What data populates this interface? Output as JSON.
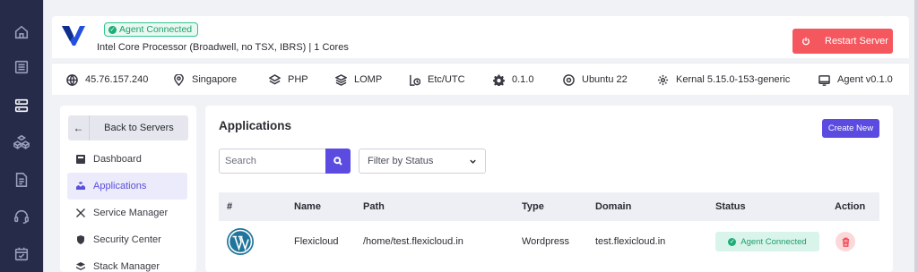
{
  "rail": {
    "items": [
      {
        "icon": "home-icon"
      },
      {
        "icon": "list-icon"
      },
      {
        "icon": "server-icon",
        "active": true
      },
      {
        "icon": "cubes-icon"
      },
      {
        "icon": "document-icon"
      },
      {
        "icon": "headset-icon"
      },
      {
        "icon": "calendar-icon"
      }
    ]
  },
  "server": {
    "status_badge": "Agent Connected",
    "cpu": "Intel Core Processor (Broadwell, no TSX, IBRS) | 1 Cores",
    "restart_label": "Restart Server"
  },
  "info": {
    "ip": "45.76.157.240",
    "location": "Singapore",
    "language": "PHP",
    "stack": "LOMP",
    "timezone": "Etc/UTC",
    "version": "0.1.0",
    "os": "Ubuntu 22",
    "kernel": "Kernal 5.15.0-153-generic",
    "agent": "Agent v0.1.0"
  },
  "nav": {
    "back_label": "Back to Servers",
    "items": [
      {
        "label": "Dashboard",
        "icon": "dashboard-icon"
      },
      {
        "label": "Applications",
        "icon": "apps-icon",
        "active": true
      },
      {
        "label": "Service Manager",
        "icon": "tools-icon"
      },
      {
        "label": "Security Center",
        "icon": "shield-icon"
      },
      {
        "label": "Stack Manager",
        "icon": "stack-icon"
      }
    ]
  },
  "apps": {
    "title": "Applications",
    "create_label": "Create New",
    "search_placeholder": "Search",
    "filter_label": "Filter by Status",
    "columns": [
      "#",
      "Name",
      "Path",
      "Type",
      "Domain",
      "Status",
      "Action"
    ],
    "rows": [
      {
        "icon": "wordpress-icon",
        "name": "Flexicloud",
        "path": "/home/test.flexicloud.in",
        "type": "Wordpress",
        "domain": "test.flexicloud.in",
        "status": "Agent Connected"
      }
    ]
  },
  "colors": {
    "accent": "#5b4be0",
    "danger": "#f4575e",
    "success": "#1eae75",
    "rail_bg": "#272b4a"
  }
}
